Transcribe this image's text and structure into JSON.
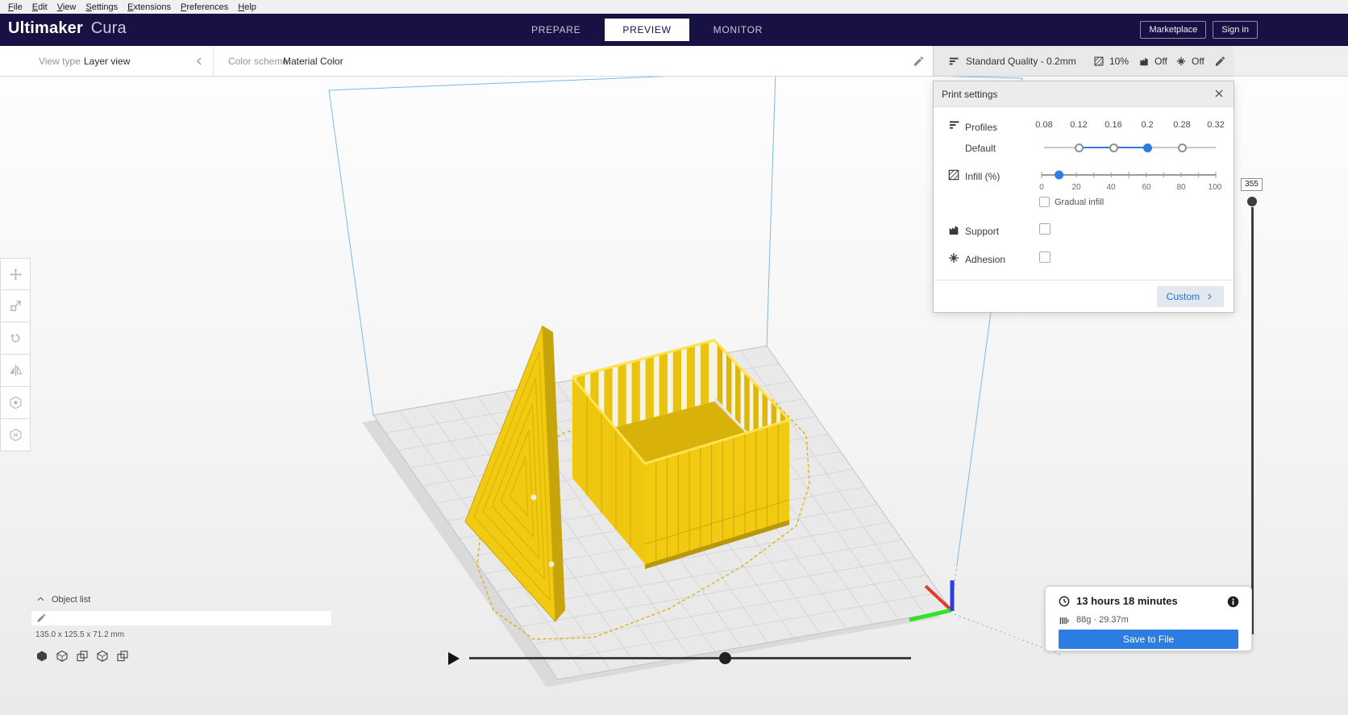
{
  "colors": {
    "accent_blue": "#2b7de2",
    "header_navy": "#171243",
    "model_yellow": "#f2ca11",
    "model_yellow_dark": "#c9a50a",
    "model_yellow_light": "#ffe14a",
    "model_yellow_shadow": "#d9b40b",
    "wireframe_blue": "#7db8e8",
    "axis_red": "#e03b2e",
    "axis_green": "#2ee51f",
    "axis_blue": "#2f3de0",
    "plate_gray": "#e9e9e9",
    "slider_dark": "#3d3d3d"
  },
  "menu": {
    "items": [
      "File",
      "Edit",
      "View",
      "Settings",
      "Extensions",
      "Preferences",
      "Help"
    ]
  },
  "header": {
    "logo_bold": "Ultimaker",
    "logo_light": "Cura",
    "tabs": [
      {
        "label": "PREPARE"
      },
      {
        "label": "PREVIEW"
      },
      {
        "label": "MONITOR"
      }
    ],
    "active_tab": "PREVIEW",
    "marketplace_label": "Marketplace",
    "signin_label": "Sign in"
  },
  "view_toolbar": {
    "view_type_label": "View type",
    "view_type_value": "Layer view",
    "color_scheme_label": "Color scheme",
    "color_scheme_value": "Material Color"
  },
  "print_setup_bar": {
    "profile_summary": "Standard Quality - 0.2mm",
    "infill_value": "10%",
    "support_value": "Off",
    "adhesion_value": "Off"
  },
  "print_settings": {
    "title": "Print settings",
    "profiles_label": "Profiles",
    "profile_values": [
      "0.08",
      "0.12",
      "0.16",
      "0.2",
      "0.28",
      "0.32"
    ],
    "selected_profile": "0.2",
    "default_label": "Default",
    "infill_label": "Infill (%)",
    "infill_percent": 10,
    "infill_ticks": [
      "0",
      "20",
      "40",
      "60",
      "80",
      "100"
    ],
    "gradual_infill_label": "Gradual infill",
    "gradual_infill_checked": false,
    "support_label": "Support",
    "support_checked": false,
    "adhesion_label": "Adhesion",
    "adhesion_checked": false,
    "custom_label": "Custom"
  },
  "layer_slider": {
    "max_layer": "355"
  },
  "object_list": {
    "label": "Object list",
    "model_dimensions": "135.0 x 125.5 x 71.2 mm"
  },
  "job_summary": {
    "print_time": "13 hours 18 minutes",
    "material_usage": "88g · 29.37m",
    "save_button_label": "Save to File"
  }
}
